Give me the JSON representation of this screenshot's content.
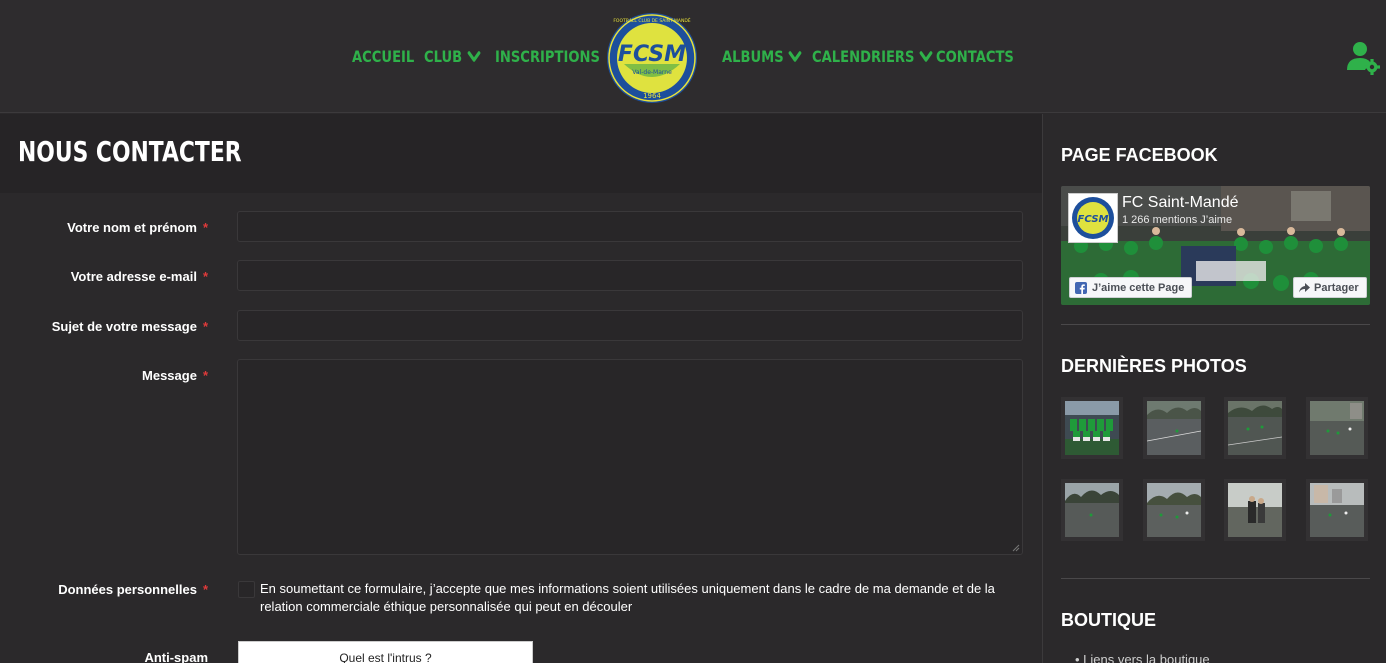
{
  "nav": {
    "items": [
      {
        "label": "ACCUEIL",
        "has_dropdown": false
      },
      {
        "label": "CLUB",
        "has_dropdown": true
      },
      {
        "label": "INSCRIPTIONS",
        "has_dropdown": false
      },
      {
        "label": "ALBUMS",
        "has_dropdown": true
      },
      {
        "label": "CALENDRIERS",
        "has_dropdown": true
      },
      {
        "label": "CONTACTS",
        "has_dropdown": false
      }
    ],
    "logo": {
      "text": "FCSM",
      "ring_text": "FOOTBALL CLUB DE SAINT-MANDÉ",
      "region": "Val-de-Marne",
      "year": "1964"
    },
    "accent_color": "#2fb14a",
    "user_icon": "user-settings-icon"
  },
  "page": {
    "title": "NOUS CONTACTER"
  },
  "form": {
    "fields": [
      {
        "label": "Votre nom et prénom",
        "value": "",
        "required": "*"
      },
      {
        "label": "Votre adresse e-mail",
        "value": "",
        "required": "*"
      },
      {
        "label": "Sujet de votre message",
        "value": "",
        "required": "*"
      },
      {
        "label": "Message",
        "value": "",
        "required": "*"
      }
    ],
    "consent": {
      "label": "Données personnelles",
      "required": "*",
      "text": "En soumettant ce formulaire, j’accepte que mes informations soient utilisées uniquement dans le cadre de ma demande et de la relation commerciale éthique personnalisée qui peut en découler",
      "checked": false
    },
    "antispam": {
      "label": "Anti-spam",
      "question": "Quel est l'intrus ?"
    }
  },
  "sidebar": {
    "facebook": {
      "title": "PAGE FACEBOOK",
      "page_name": "FC Saint-Mandé",
      "likes": "1 266 mentions J’aime",
      "like_button": "J’aime cette Page",
      "share_button": "Partager"
    },
    "photos": {
      "title": "DERNIÈRES PHOTOS"
    },
    "boutique": {
      "title": "BOUTIQUE",
      "first_item": "• Liens vers la boutique"
    }
  }
}
